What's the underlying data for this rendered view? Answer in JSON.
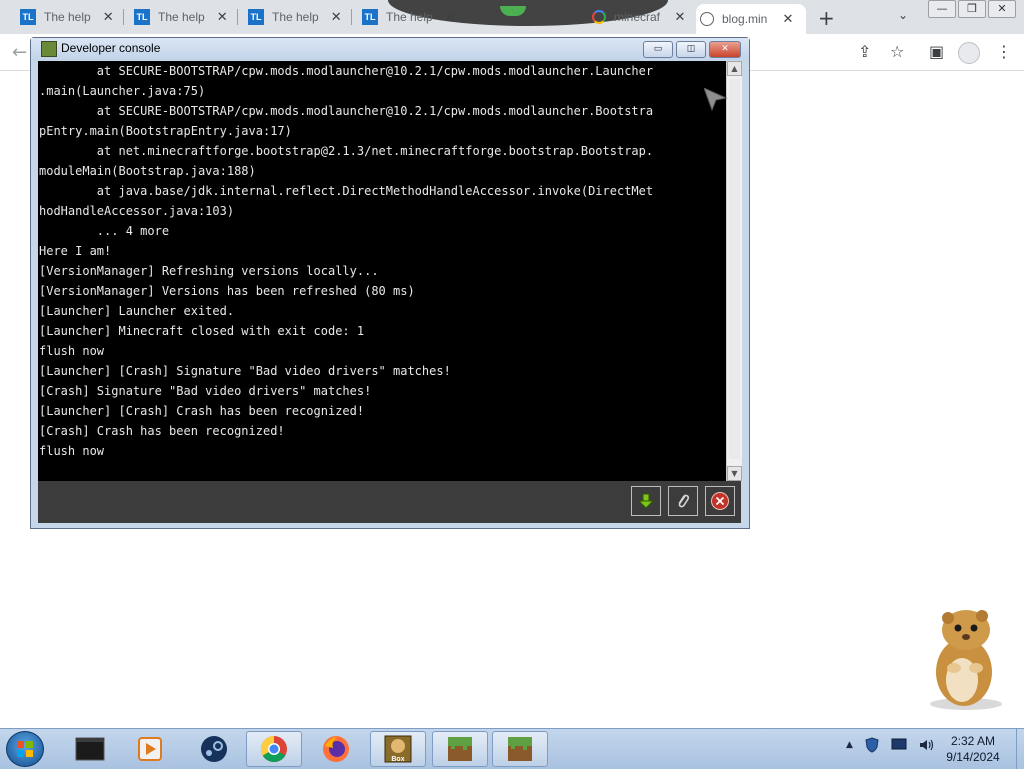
{
  "browser": {
    "tabs": [
      {
        "title": "The help",
        "close": "✕",
        "favicon": "TL",
        "kind": "tl"
      },
      {
        "title": "The help",
        "close": "✕",
        "favicon": "TL",
        "kind": "tl"
      },
      {
        "title": "The help",
        "close": "✕",
        "favicon": "TL",
        "kind": "tl"
      },
      {
        "title": "The help",
        "close": "✕",
        "favicon": "TL",
        "kind": "tl"
      },
      {
        "title": "minecraf",
        "close": "✕",
        "favicon": "google-icon",
        "kind": "google"
      },
      {
        "title": "blog.min",
        "close": "✕",
        "favicon": "globe-icon",
        "kind": "globe",
        "active": true
      }
    ],
    "new_tab": "+",
    "tab_search": "⌄",
    "window_controls": {
      "minimize": "—",
      "restore": "❐",
      "close": "✕"
    },
    "toolbar": {
      "back": "←",
      "share": "⇪",
      "bookmark": "☆",
      "side_panel": "▣",
      "menu": "⋮"
    }
  },
  "console": {
    "title": "Developer console",
    "controls": {
      "minimize": "▭",
      "maximize": "◫",
      "close": "✕"
    },
    "lines": [
      "        at SECURE-BOOTSTRAP/cpw.mods.modlauncher@10.2.1/cpw.mods.modlauncher.Launcher",
      ".main(Launcher.java:75)",
      "        at SECURE-BOOTSTRAP/cpw.mods.modlauncher@10.2.1/cpw.mods.modlauncher.Bootstra",
      "pEntry.main(BootstrapEntry.java:17)",
      "        at net.minecraftforge.bootstrap@2.1.3/net.minecraftforge.bootstrap.Bootstrap.",
      "moduleMain(Bootstrap.java:188)",
      "        at java.base/jdk.internal.reflect.DirectMethodHandleAccessor.invoke(DirectMet",
      "hodHandleAccessor.java:103)",
      "        ... 4 more",
      "Here I am!",
      "[VersionManager] Refreshing versions locally...",
      "[VersionManager] Versions has been refreshed (80 ms)",
      "[Launcher] Launcher exited.",
      "[Launcher] Minecraft closed with exit code: 1",
      "flush now",
      "[Launcher] [Crash] Signature \"Bad video drivers\" matches!",
      "[Crash] Signature \"Bad video drivers\" matches!",
      "[Launcher] [Crash] Crash has been recognized!",
      "[Crash] Crash has been recognized!",
      "flush now"
    ],
    "footer_buttons": [
      {
        "name": "download-log-button",
        "icon": "download-arrow-icon"
      },
      {
        "name": "attach-log-button",
        "icon": "paperclip-icon"
      },
      {
        "name": "close-console-button",
        "icon": "red-close-icon"
      }
    ],
    "colors": {
      "background": "#000000",
      "text": "#e8e8e8",
      "footer": "#3c3c3c"
    }
  },
  "taskbar": {
    "apps": [
      "terminal-icon",
      "media-player-icon",
      "steam-icon",
      "chrome-icon",
      "firefox-icon",
      "tlauncher-box-icon",
      "minecraft-grass-block-icon",
      "minecraft-grass-block-icon"
    ],
    "box_label": "Box",
    "tray": [
      "show-hidden-icons-arrow",
      "shield-icon",
      "monitor-icon",
      "volume-icon"
    ],
    "clock": {
      "time": "2:32 AM",
      "date": "9/14/2024"
    }
  }
}
